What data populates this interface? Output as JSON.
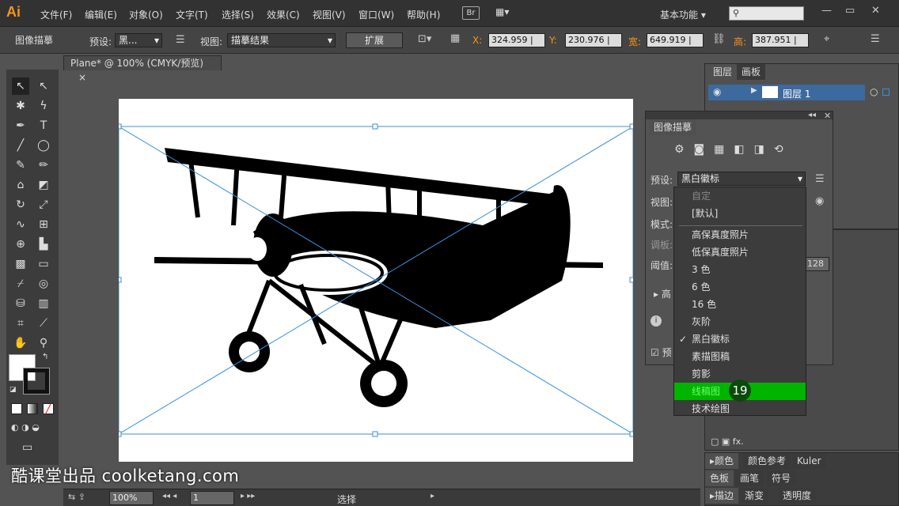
{
  "app": {
    "logo": "Ai",
    "menu": [
      "文件(F)",
      "编辑(E)",
      "对象(O)",
      "文字(T)",
      "选择(S)",
      "效果(C)",
      "视图(V)",
      "窗口(W)",
      "帮助(H)"
    ],
    "bridge": "Br",
    "workspace": "基本功能",
    "search_placeholder": ""
  },
  "control": {
    "title": "图像描摹",
    "preset_label": "预设:",
    "preset_value": "黑...",
    "view_label": "视图:",
    "view_value": "描摹结果",
    "expand": "扩展",
    "x_label": "X:",
    "x_value": "324.959 |",
    "y_label": "Y:",
    "y_value": "230.976 |",
    "w_label": "宽:",
    "w_value": "649.919 |",
    "h_label": "高:",
    "h_value": "387.951 |"
  },
  "doc": {
    "tab": "Plane* @ 100% (CMYK/预览)",
    "close": "×"
  },
  "layers": {
    "tab_layers": "图层",
    "tab_artboard": "画板",
    "layer_name": "图层 1"
  },
  "trace": {
    "title": "图像描摹",
    "preset_label": "预设:",
    "preset_value": "黑白徽标",
    "view_label": "视图:",
    "mode_label": "模式:",
    "palette_label": "调板:",
    "threshold_label": "阈值:",
    "threshold_value": "128",
    "advanced": "高",
    "preview": "预"
  },
  "preset_list": {
    "items": [
      "自定",
      "[默认]",
      "高保真度照片",
      "低保真度照片",
      "3 色",
      "6 色",
      "16 色",
      "灰阶",
      "黑白徽标",
      "素描图稿",
      "剪影",
      "线稿图",
      "技术绘图"
    ],
    "checked": "黑白徽标",
    "highlighted": "线稿图",
    "badge": "19"
  },
  "bottom_panels": {
    "color": "颜色",
    "color_guide": "颜色参考",
    "kuler": "Kuler",
    "swatches": "色板",
    "brushes": "画笔",
    "symbols": "符号",
    "stroke": "描边",
    "gradient": "渐变",
    "transparency": "透明度"
  },
  "status": {
    "zoom": "100%",
    "page": "1",
    "mode": "选择"
  },
  "watermark": "酷课堂出品 coolketang.com",
  "colors": {
    "accent": "#f7941d",
    "highlight": "#00b400",
    "selection": "#3a8fd9"
  }
}
